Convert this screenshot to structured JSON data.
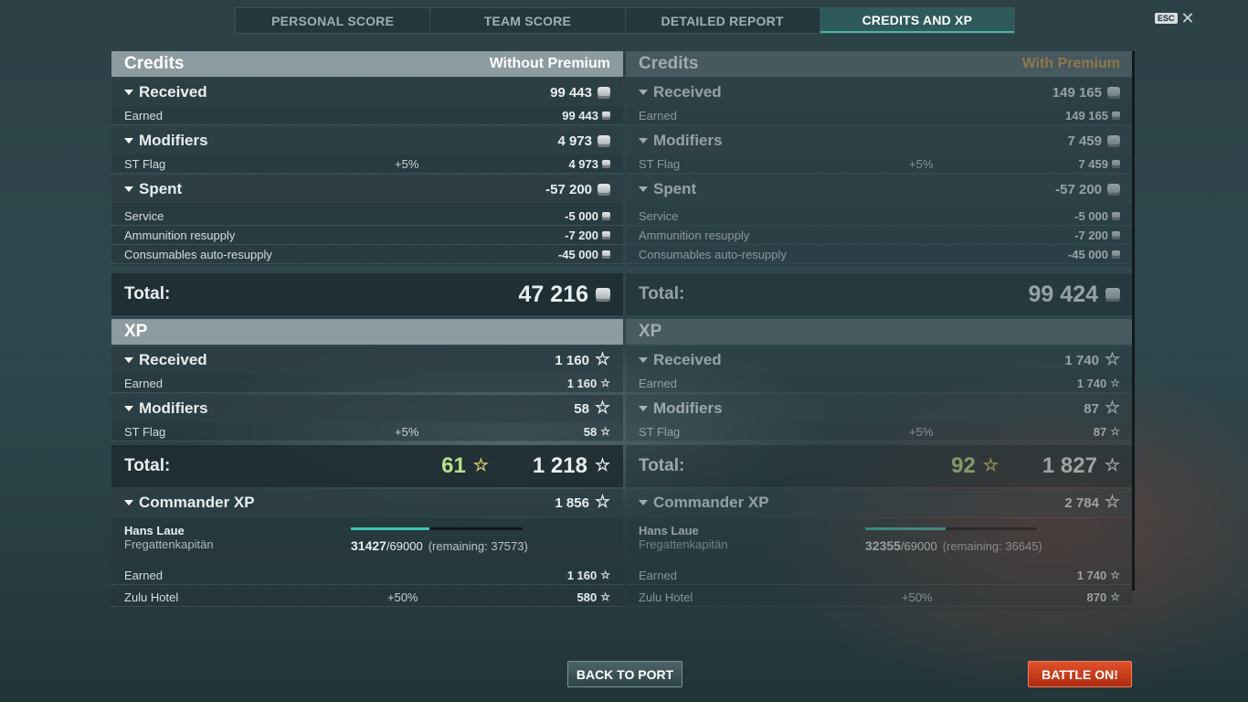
{
  "tabs": [
    "PERSONAL SCORE",
    "TEAM SCORE",
    "DETAILED REPORT",
    "CREDITS AND XP"
  ],
  "esc_label": "ESC",
  "colors": {
    "active_tab": "#2e5a5c",
    "premium_label": "#e0a44a",
    "battle_button": "#d0401c",
    "xp_bonus": "#b8e08a"
  },
  "left": {
    "credits_title": "Credits",
    "credits_subtitle": "Without Premium",
    "received_label": "Received",
    "received_value": "99 443",
    "earned_label": "Earned",
    "earned_value": "99 443",
    "modifiers_label": "Modifiers",
    "modifiers_value": "4 973",
    "stflag_label": "ST Flag",
    "stflag_pct": "+5%",
    "stflag_value": "4 973",
    "spent_label": "Spent",
    "spent_value": "-57 200",
    "service_label": "Service",
    "service_value": "-5 000",
    "ammo_label": "Ammunition resupply",
    "ammo_value": "-7 200",
    "cons_label": "Consumables auto-resupply",
    "cons_value": "-45 000",
    "total_label": "Total:",
    "total_value": "47 216",
    "xp_title": "XP",
    "xp_received_label": "Received",
    "xp_received_value": "1 160",
    "xp_earned_label": "Earned",
    "xp_earned_value": "1 160",
    "xp_modifiers_label": "Modifiers",
    "xp_modifiers_value": "58",
    "xp_stflag_label": "ST Flag",
    "xp_stflag_pct": "+5%",
    "xp_stflag_value": "58",
    "xp_total_label": "Total:",
    "xp_bonus_value": "61",
    "xp_total_value": "1 218",
    "cmd_label": "Commander XP",
    "cmd_value": "1 856",
    "cmd_name": "Hans Laue",
    "cmd_rank": "Fregattenkapitän",
    "cmd_xp_current": "31427",
    "cmd_xp_max": "/69000",
    "cmd_remaining": "(remaining: 37573)",
    "cmd_progress": 0.455,
    "cmd_earned_label": "Earned",
    "cmd_earned_value": "1 160",
    "cmd_zulu_label": "Zulu Hotel",
    "cmd_zulu_pct": "+50%",
    "cmd_zulu_value": "580"
  },
  "right": {
    "credits_title": "Credits",
    "credits_subtitle": "With Premium",
    "received_label": "Received",
    "received_value": "149 165",
    "earned_label": "Earned",
    "earned_value": "149 165",
    "modifiers_label": "Modifiers",
    "modifiers_value": "7 459",
    "stflag_label": "ST Flag",
    "stflag_pct": "+5%",
    "stflag_value": "7 459",
    "spent_label": "Spent",
    "spent_value": "-57 200",
    "service_label": "Service",
    "service_value": "-5 000",
    "ammo_label": "Ammunition resupply",
    "ammo_value": "-7 200",
    "cons_label": "Consumables auto-resupply",
    "cons_value": "-45 000",
    "total_label": "Total:",
    "total_value": "99 424",
    "xp_title": "XP",
    "xp_received_label": "Received",
    "xp_received_value": "1 740",
    "xp_earned_label": "Earned",
    "xp_earned_value": "1 740",
    "xp_modifiers_label": "Modifiers",
    "xp_modifiers_value": "87",
    "xp_stflag_label": "ST Flag",
    "xp_stflag_pct": "+5%",
    "xp_stflag_value": "87",
    "xp_total_label": "Total:",
    "xp_bonus_value": "92",
    "xp_total_value": "1 827",
    "cmd_label": "Commander XP",
    "cmd_value": "2 784",
    "cmd_name": "Hans Laue",
    "cmd_rank": "Fregattenkapitän",
    "cmd_xp_current": "32355",
    "cmd_xp_max": "/69000",
    "cmd_remaining": "(remaining: 36645)",
    "cmd_progress": 0.469,
    "cmd_earned_label": "Earned",
    "cmd_earned_value": "1 740",
    "cmd_zulu_label": "Zulu Hotel",
    "cmd_zulu_pct": "+50%",
    "cmd_zulu_value": "870"
  },
  "buttons": {
    "back": "BACK TO PORT",
    "battle": "BATTLE ON!"
  }
}
